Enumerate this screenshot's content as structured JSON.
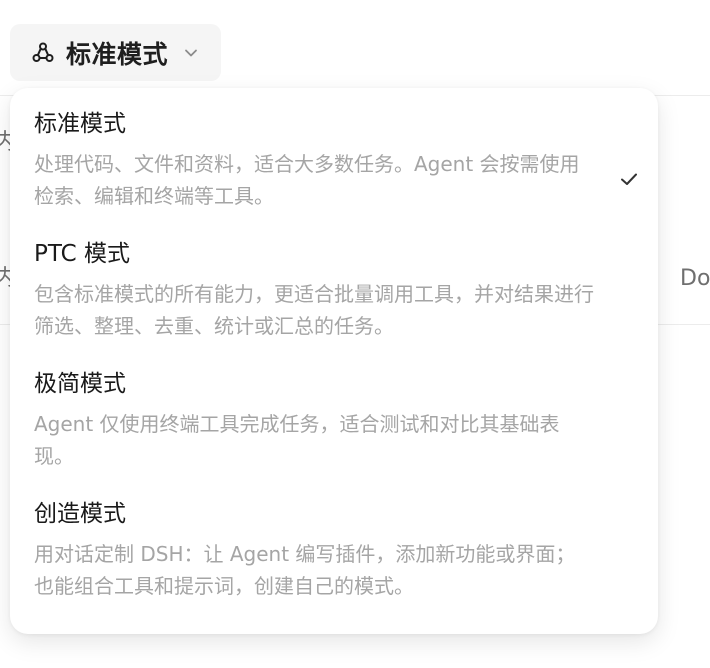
{
  "header": {
    "selected_mode_label": "标准模式",
    "icon": "mode-icon",
    "dropdown_icon": "chevron-down-icon"
  },
  "background": {
    "left_text_1": "内",
    "left_text_2": "内",
    "right_text": "Do"
  },
  "menu": {
    "options": [
      {
        "title": "标准模式",
        "description": "处理代码、文件和资料，适合大多数任务。Agent 会按需使用检索、编辑和终端等工具。",
        "selected": true
      },
      {
        "title": "PTC 模式",
        "description": "包含标准模式的所有能力，更适合批量调用工具，并对结果进行筛选、整理、去重、统计或汇总的任务。",
        "selected": false
      },
      {
        "title": "极简模式",
        "description": "Agent 仅使用终端工具完成任务，适合测试和对比其基础表现。",
        "selected": false
      },
      {
        "title": "创造模式",
        "description": "用对话定制 DSH：让 Agent 编写插件，添加新功能或界面；也能组合工具和提示词，创建自己的模式。",
        "selected": false
      }
    ]
  },
  "colors": {
    "title": "#1a1a1a",
    "description": "#a5a5a5",
    "trigger_background": "#f5f5f5"
  }
}
